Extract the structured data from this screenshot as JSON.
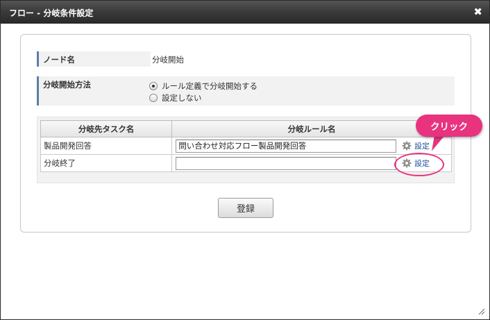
{
  "dialog": {
    "title": "フロー - 分岐条件設定",
    "close_glyph": "✖"
  },
  "form": {
    "node_label": "ノード名",
    "node_value": "分岐開始",
    "method_label": "分岐開始方法",
    "method_options": [
      {
        "label": "ルール定義で分岐開始する",
        "selected": true
      },
      {
        "label": "設定しない",
        "selected": false
      }
    ]
  },
  "table": {
    "headers": [
      "分岐先タスク名",
      "分岐ルール名"
    ],
    "rows": [
      {
        "task": "製品開発回答",
        "rule": "問い合わせ対応フロー製品開発回答",
        "set_label": "設定"
      },
      {
        "task": "分岐終了",
        "rule": "",
        "set_label": "設定"
      }
    ]
  },
  "register_label": "登録",
  "annotation": {
    "label": "クリック",
    "color": "#e8337f"
  },
  "colors": {
    "titlebar": "#3a3a3a",
    "label_accent": "#5b7ea7",
    "link": "#1b4f9a"
  },
  "icons": {
    "close": "close-icon",
    "gear": "gear-icon",
    "radio_selected": "radio-selected",
    "radio_unselected": "radio-unselected",
    "resize": "resize-grip-icon"
  }
}
